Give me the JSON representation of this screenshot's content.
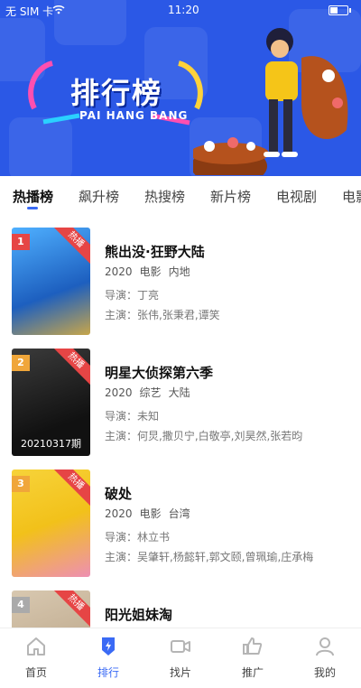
{
  "status": {
    "carrier": "无 SIM 卡",
    "time": "11:20"
  },
  "banner": {
    "title": "排行榜",
    "subtitle": "PAI HANG BANG"
  },
  "tabs": [
    {
      "label": "热播榜"
    },
    {
      "label": "飙升榜"
    },
    {
      "label": "热搜榜"
    },
    {
      "label": "新片榜"
    },
    {
      "label": "电视剧"
    },
    {
      "label": "电影"
    }
  ],
  "list": [
    {
      "rank": "1",
      "badge": "热播",
      "title": "熊出没·狂野大陆",
      "year": "2020",
      "type": "电影",
      "region": "内地",
      "director": "导演：丁亮",
      "cast": "主演：张伟,张秉君,谭笑",
      "color": "#2c7ad6"
    },
    {
      "rank": "2",
      "badge": "热播",
      "title": "明星大侦探第六季",
      "year": "2020",
      "type": "综艺",
      "region": "大陆",
      "director": "导演：未知",
      "cast": "主演：何炅,撒贝宁,白敬亭,刘昊然,张若昀",
      "episode": "20210317期",
      "color": "#1b1b1b"
    },
    {
      "rank": "3",
      "badge": "热播",
      "title": "破处",
      "year": "2020",
      "type": "电影",
      "region": "台湾",
      "director": "导演：林立书",
      "cast": "主演：吴肇轩,杨懿轩,郭文颐,曾珮瑜,庄承梅",
      "color": "#f2c11a"
    },
    {
      "rank": "4",
      "badge": "热播",
      "title": "阳光姐妹淘",
      "year": "",
      "type": "",
      "region": "",
      "director": "",
      "cast": "",
      "color": "#c9b49a"
    }
  ],
  "nav": [
    {
      "label": "首页",
      "icon": "home-icon"
    },
    {
      "label": "排行",
      "icon": "ranking-icon"
    },
    {
      "label": "找片",
      "icon": "video-camera-icon"
    },
    {
      "label": "推广",
      "icon": "thumbs-up-icon"
    },
    {
      "label": "我的",
      "icon": "user-icon"
    }
  ],
  "colors": {
    "accent": "#3a6af5",
    "banner": "#2b58e6",
    "hot": "#e64545"
  }
}
